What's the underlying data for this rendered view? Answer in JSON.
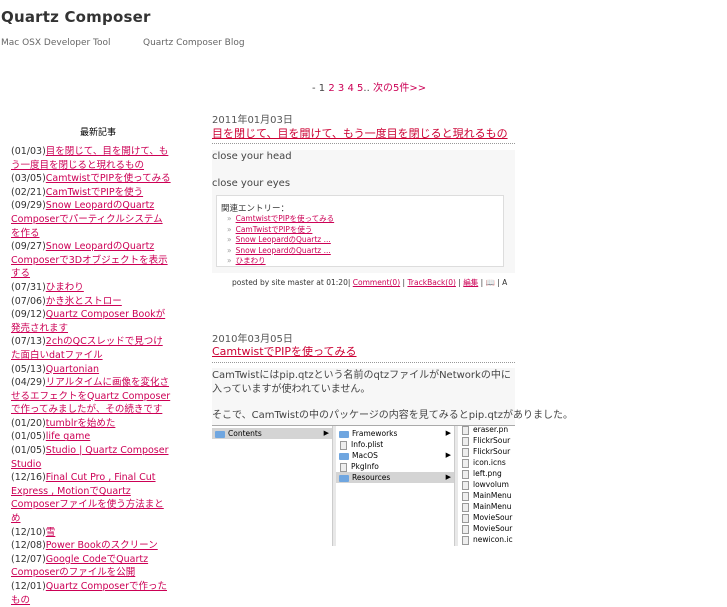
{
  "site": {
    "title": "Quartz Composer",
    "nav_left": "Mac OSX Developer Tool",
    "nav_right": "Quartz Composer  Blog"
  },
  "pager": {
    "prefix": "- ",
    "current": "1",
    "pages": [
      "2",
      "3",
      "4",
      "5"
    ],
    "ellipsis": "..",
    "next": "次の5件>>"
  },
  "sidebar": {
    "title": "最新記事",
    "items": [
      {
        "date": "(01/03)",
        "title": "目を閉じて、目を開けて、もう一度目を閉じると現れるもの"
      },
      {
        "date": "(03/05)",
        "title": "CamtwistでPIPを使ってみる"
      },
      {
        "date": "(02/21)",
        "title": "CamTwistでPIPを使う"
      },
      {
        "date": "(09/29)",
        "title": "Snow LeopardのQuartz Composerでパーティクルシステムを作る"
      },
      {
        "date": "(09/27)",
        "title": "Snow LeopardのQuartz Composerで3Dオブジェクトを表示する"
      },
      {
        "date": "(07/31)",
        "title": "ひまわり"
      },
      {
        "date": "(07/06)",
        "title": "かき氷とストロー"
      },
      {
        "date": "(09/12)",
        "title": "Quartz Composer Bookが発売されます"
      },
      {
        "date": "(07/13)",
        "title": "2chのQCスレッドで見つけた面白いdatファイル"
      },
      {
        "date": "(05/13)",
        "title": "Quartonian"
      },
      {
        "date": "(04/29)",
        "title": "リアルタイムに画像を変化させるエフェクトをQuartz Composerで作ってみましたが、その続きです"
      },
      {
        "date": "(01/20)",
        "title": "tumblrを始めた"
      },
      {
        "date": "(01/05)",
        "title": "life game"
      },
      {
        "date": "(01/05)",
        "title": "Studio | Quartz Composer Studio"
      },
      {
        "date": "(12/16)",
        "title": "Final Cut Pro , Final Cut Express , MotionでQuartz Composerファイルを使う方法まとめ"
      },
      {
        "date": "(12/10)",
        "title": "雪"
      },
      {
        "date": "(12/08)",
        "title": "Power Bookのスクリーン"
      },
      {
        "date": "(12/07)",
        "title": "Google CodeでQuartz Composerのファイルを公開"
      },
      {
        "date": "(12/01)",
        "title": "Quartz Composerで作ったもの"
      }
    ]
  },
  "entry1": {
    "date": "2011年01月03日",
    "title": "目を閉じて、目を開けて、もう一度目を閉じると現れるもの",
    "line1": "close your head",
    "line2": "close your eyes",
    "related_title": "関連エントリー：",
    "related": [
      "CamtwistでPIPを使ってみる",
      "CamTwistでPIPを使う",
      "Snow LeopardのQuartz ...",
      "Snow LeopardのQuartz ...",
      "ひまわり"
    ],
    "footer": {
      "posted": "posted by site master at 01:20|",
      "comment": "Comment(0)",
      "trackback": "TrackBack(0)",
      "sep": "|",
      "edit": "編集",
      "icons": "| 📖 | A"
    }
  },
  "entry2": {
    "date": "2010年03月05日",
    "title": "CamtwistでPIPを使ってみる",
    "p1": "CamTwistにはpip.qtzという名前のqtzファイルがNetworkの中に入っていますが使われていません。",
    "p2": "そこで、CamTwistの中のパッケージの内容を見てみるとpip.qtzがありました。"
  },
  "finder": {
    "col1": [
      {
        "name": "Contents",
        "selected": "gray"
      }
    ],
    "col2": [
      {
        "name": "Frameworks",
        "type": "folder"
      },
      {
        "name": "Info.plist",
        "type": "file"
      },
      {
        "name": "MacOS",
        "type": "folder"
      },
      {
        "name": "PkgInfo",
        "type": "file"
      },
      {
        "name": "Resources",
        "type": "folder",
        "selected": "gray"
      }
    ],
    "col3": [
      "eraser.pn",
      "FlickrSour",
      "FlickrSour",
      "icon.icns",
      "left.png",
      "lowvolum",
      "MainMenu",
      "MainMenu",
      "MovieSour",
      "MovieSour",
      "newicon.ic"
    ]
  }
}
